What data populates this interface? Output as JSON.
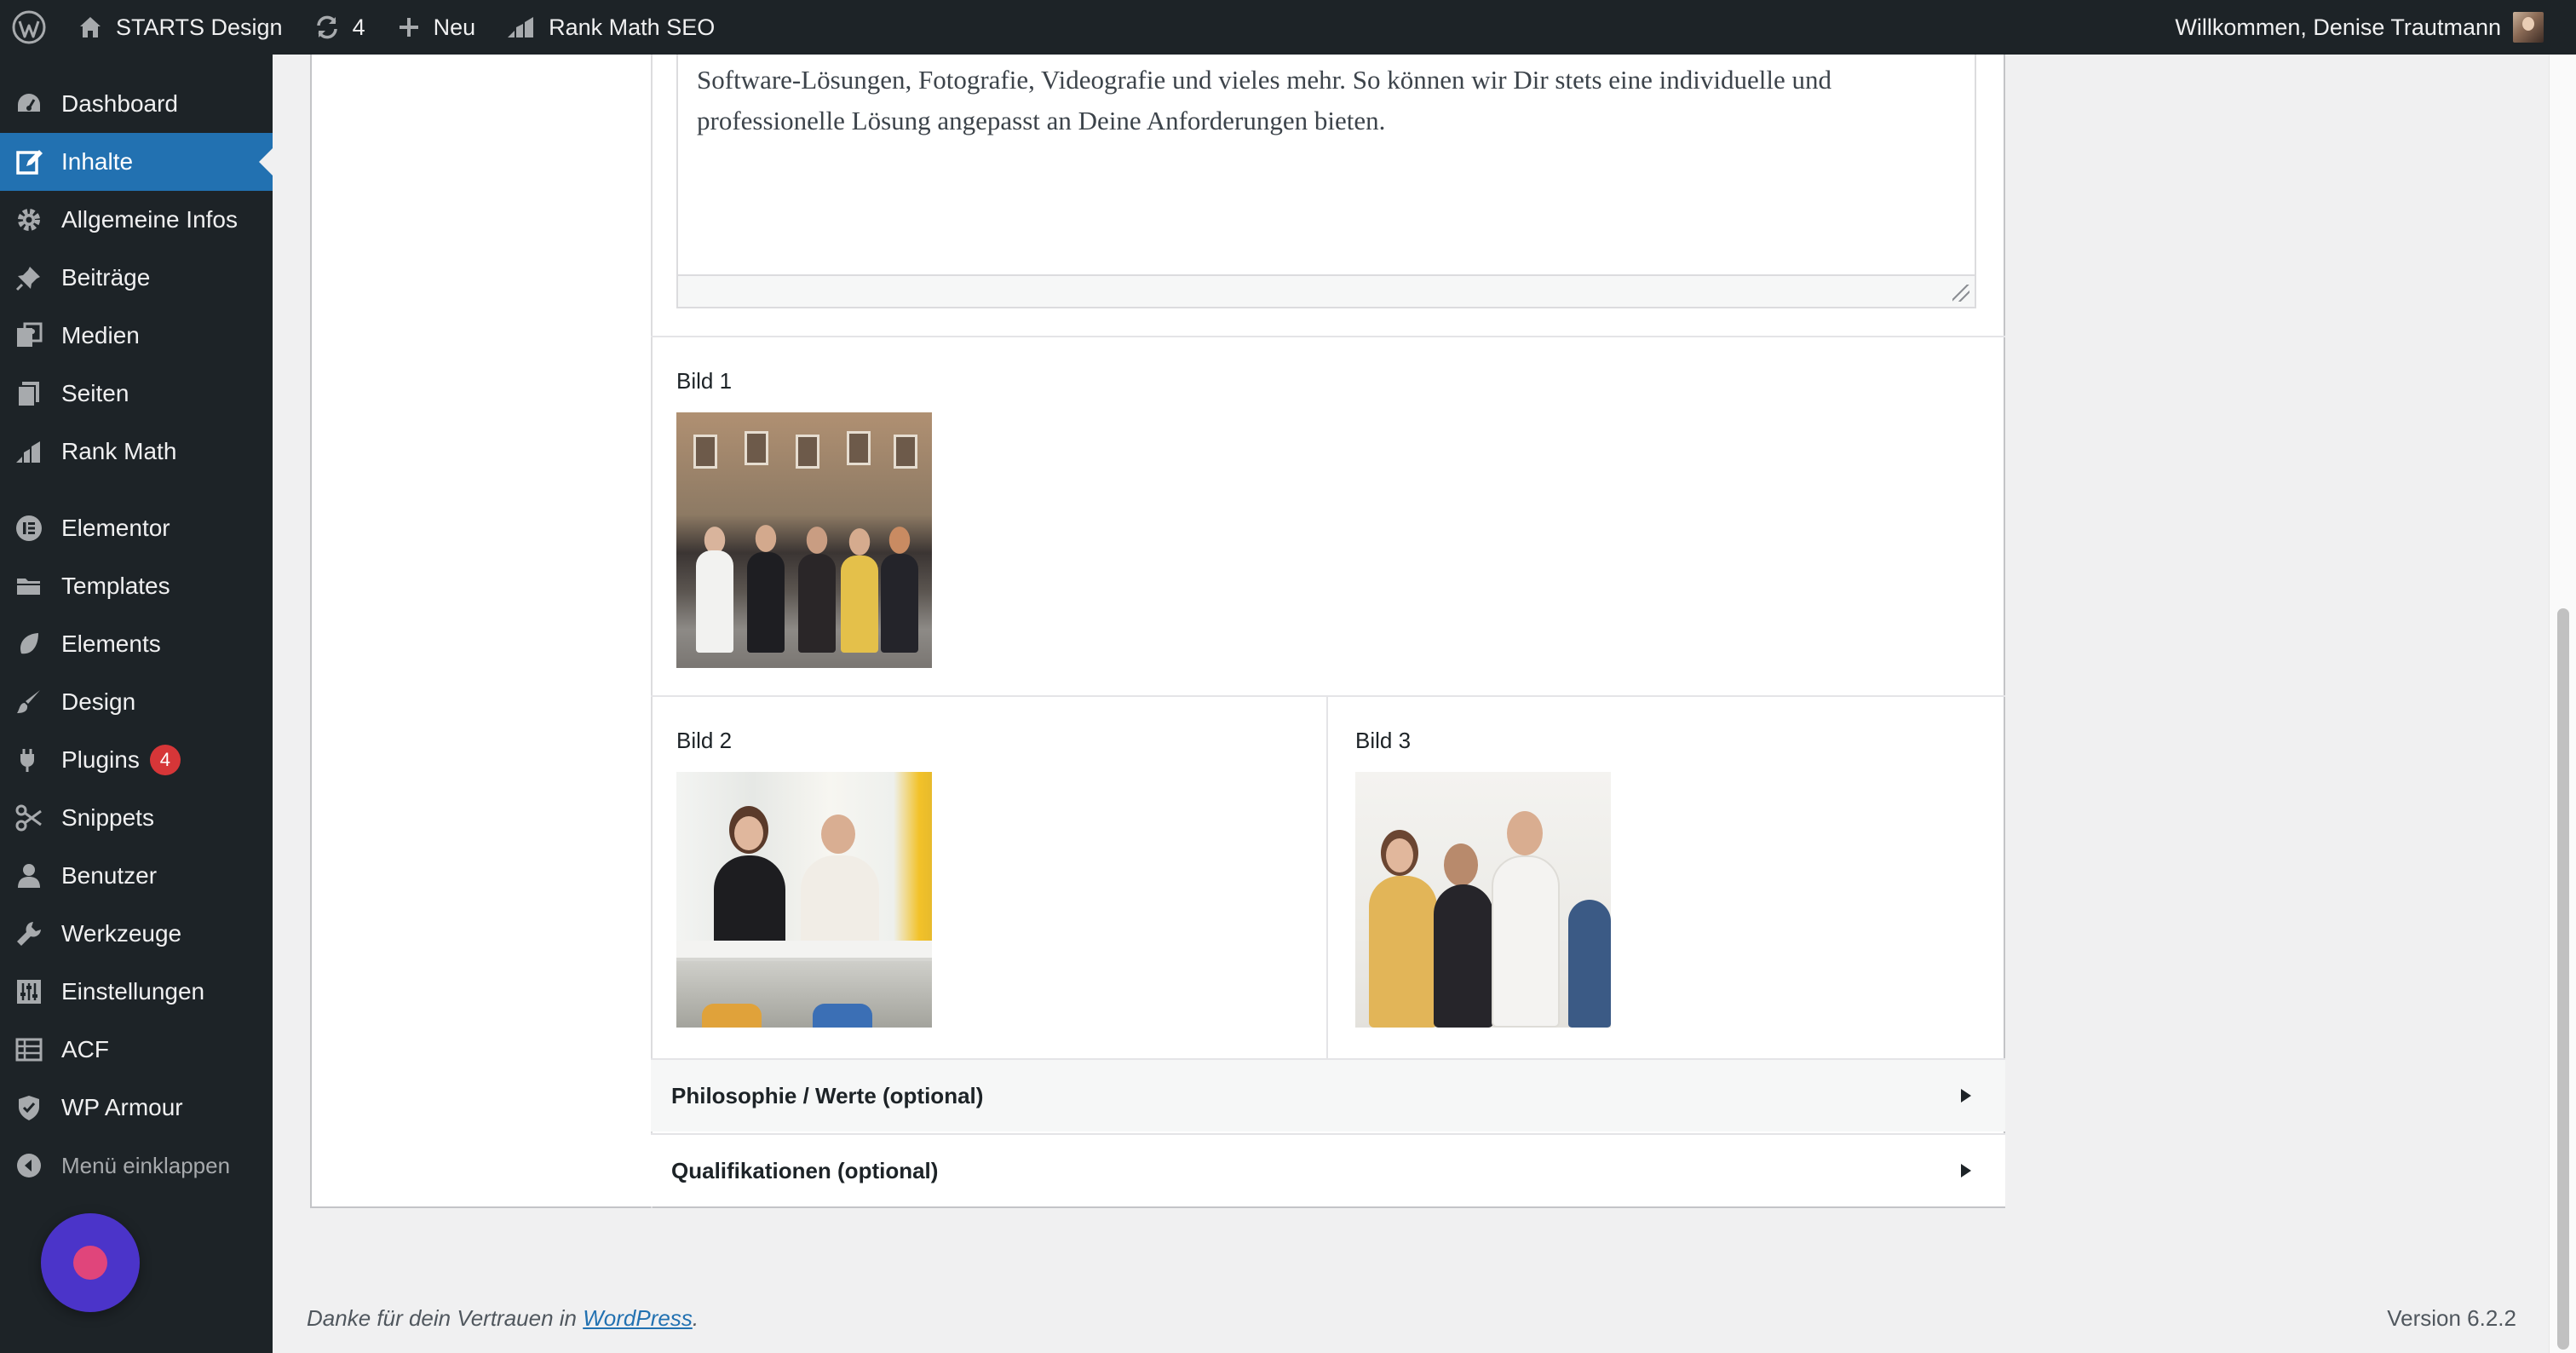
{
  "adminbar": {
    "site_name": "STARTS Design",
    "updates_count": "4",
    "new_label": "Neu",
    "seo_label": "Rank Math SEO",
    "welcome": "Willkommen, Denise Trautmann"
  },
  "sidebar": {
    "items": [
      {
        "label": "Dashboard",
        "icon": "dashboard-icon"
      },
      {
        "label": "Inhalte",
        "icon": "edit-icon",
        "active": true
      },
      {
        "label": "Allgemeine Infos",
        "icon": "gear-icon"
      },
      {
        "label": "Beiträge",
        "icon": "pin-icon"
      },
      {
        "label": "Medien",
        "icon": "media-icon"
      },
      {
        "label": "Seiten",
        "icon": "pages-icon"
      },
      {
        "label": "Rank Math",
        "icon": "rank-math-icon"
      },
      {
        "label": "Elementor",
        "icon": "elementor-icon"
      },
      {
        "label": "Templates",
        "icon": "folder-icon"
      },
      {
        "label": "Elements",
        "icon": "leaf-icon"
      },
      {
        "label": "Design",
        "icon": "brush-icon"
      },
      {
        "label": "Plugins",
        "icon": "plugin-icon",
        "badge": "4"
      },
      {
        "label": "Snippets",
        "icon": "scissors-icon"
      },
      {
        "label": "Benutzer",
        "icon": "user-icon"
      },
      {
        "label": "Werkzeuge",
        "icon": "wrench-icon"
      },
      {
        "label": "Einstellungen",
        "icon": "sliders-icon"
      },
      {
        "label": "ACF",
        "icon": "table-icon"
      },
      {
        "label": "WP Armour",
        "icon": "shield-icon"
      }
    ],
    "collapse_label": "Menü einklappen"
  },
  "editor": {
    "text": "Software-Lösungen, Fotografie, Videografie und vieles mehr. So können wir Dir stets eine individuelle und professionelle Lösung angepasst an Deine Anforderungen bieten."
  },
  "fields": {
    "bild1_label": "Bild 1",
    "bild2_label": "Bild 2",
    "bild3_label": "Bild 3"
  },
  "accordions": {
    "philosophie": "Philosophie / Werte (optional)",
    "qualifikationen": "Qualifikationen (optional)"
  },
  "footer": {
    "thanks_prefix": "Danke für dein Vertrauen in ",
    "thanks_link": "WordPress",
    "thanks_suffix": ".",
    "version": "Version 6.2.2"
  },
  "colors": {
    "sidebar_bg": "#1d2327",
    "active": "#2271b1",
    "badge": "#d63638",
    "link": "#2271b1"
  }
}
